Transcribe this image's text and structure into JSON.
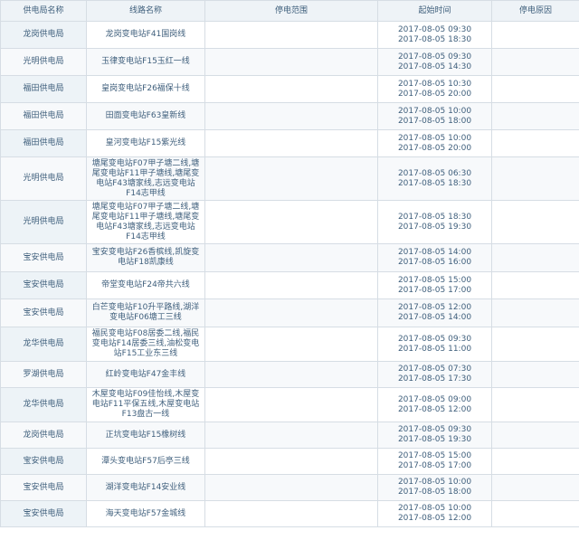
{
  "headers": {
    "bureau": "供电局名称",
    "line": "线路名称",
    "scope": "停电范围",
    "time": "起始时间",
    "reason": "停电原因"
  },
  "rows": [
    {
      "bureau": "龙岗供电局",
      "line": "龙岗变电站F41国岗线",
      "start": "2017-08-05 09:30",
      "end": "2017-08-05 18:30"
    },
    {
      "bureau": "光明供电局",
      "line": "玉律变电站F15玉红一线",
      "start": "2017-08-05 09:30",
      "end": "2017-08-05 14:30"
    },
    {
      "bureau": "福田供电局",
      "line": "皇岗变电站F26福保十线",
      "start": "2017-08-05 10:30",
      "end": "2017-08-05 20:00"
    },
    {
      "bureau": "福田供电局",
      "line": "田面变电站F63皇新线",
      "start": "2017-08-05 10:00",
      "end": "2017-08-05 18:00"
    },
    {
      "bureau": "福田供电局",
      "line": "皇河变电站F15紫光线",
      "start": "2017-08-05 10:00",
      "end": "2017-08-05 20:00"
    },
    {
      "bureau": "光明供电局",
      "line": "塘尾变电站F07甲子塘二线,塘尾变电站F11甲子塘线,塘尾变电站F43塘家线,志远变电站F14志甲线",
      "start": "2017-08-05 06:30",
      "end": "2017-08-05 18:30"
    },
    {
      "bureau": "光明供电局",
      "line": "塘尾变电站F07甲子塘二线,塘尾变电站F11甲子塘线,塘尾变电站F43塘家线,志远变电站F14志甲线",
      "start": "2017-08-05 18:30",
      "end": "2017-08-05 19:30"
    },
    {
      "bureau": "宝安供电局",
      "line": "宝安变电站F26香槟线,凯旋变电站F18凯康线",
      "start": "2017-08-05 14:00",
      "end": "2017-08-05 16:00"
    },
    {
      "bureau": "宝安供电局",
      "line": "帝堂变电站F24帝共六线",
      "start": "2017-08-05 15:00",
      "end": "2017-08-05 17:00"
    },
    {
      "bureau": "宝安供电局",
      "line": "白芒变电站F10升平路线,湖洋变电站F06塘工三线",
      "start": "2017-08-05 12:00",
      "end": "2017-08-05 14:00"
    },
    {
      "bureau": "龙华供电局",
      "line": "福民变电站F08居委二线,福民变电站F14居委三线,油松变电站F15工业东三线",
      "start": "2017-08-05 09:30",
      "end": "2017-08-05 11:00"
    },
    {
      "bureau": "罗湖供电局",
      "line": "红岭变电站F47金丰线",
      "start": "2017-08-05 07:30",
      "end": "2017-08-05 17:30"
    },
    {
      "bureau": "龙华供电局",
      "line": "木屋变电站F09佳怡线,木屋变电站F11平保五线,木屋变电站F13盘古一线",
      "start": "2017-08-05 09:00",
      "end": "2017-08-05 12:00"
    },
    {
      "bureau": "龙岗供电局",
      "line": "正坑变电站F15橡树线",
      "start": "2017-08-05 09:30",
      "end": "2017-08-05 19:30"
    },
    {
      "bureau": "宝安供电局",
      "line": "潭头变电站F57后亭三线",
      "start": "2017-08-05 15:00",
      "end": "2017-08-05 17:00"
    },
    {
      "bureau": "宝安供电局",
      "line": "湖洋变电站F14安业线",
      "start": "2017-08-05 10:00",
      "end": "2017-08-05 18:00"
    },
    {
      "bureau": "宝安供电局",
      "line": "海天变电站F57金城线",
      "start": "2017-08-05 10:00",
      "end": "2017-08-05 12:00"
    }
  ]
}
